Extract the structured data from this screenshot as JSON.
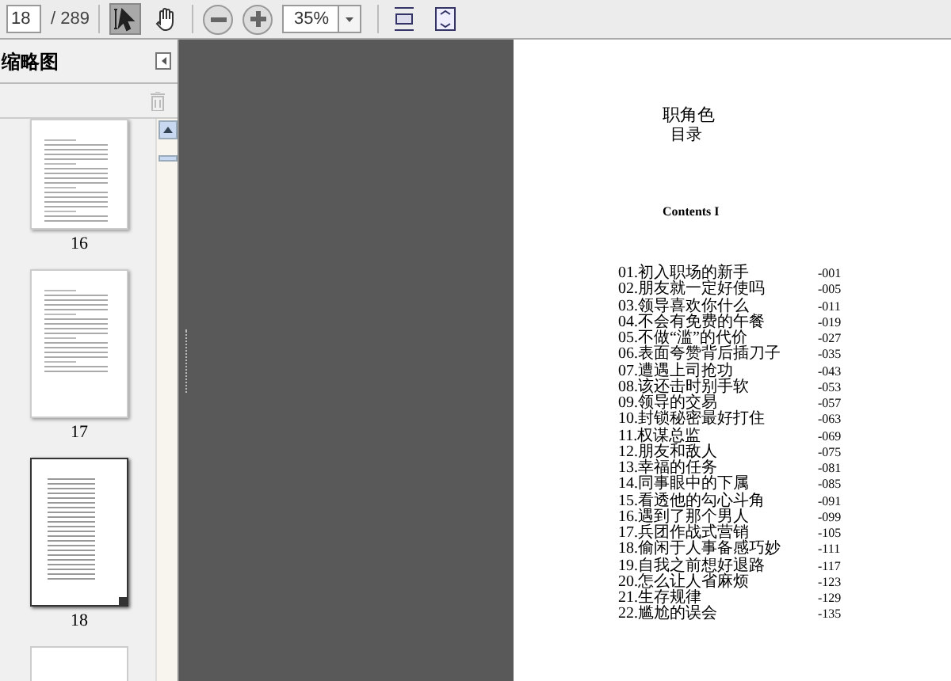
{
  "toolbar": {
    "page_field": "18",
    "page_count": "/ 289",
    "tools": [
      {
        "kind": "select",
        "selected": true
      },
      {
        "kind": "hand",
        "selected": false
      }
    ],
    "zoom": "35%"
  },
  "thumbnails_panel": {
    "title": "缩略图",
    "pages": [
      {
        "label": "16",
        "kind": "text",
        "selected": false
      },
      {
        "label": "17",
        "kind": "text",
        "selected": false
      },
      {
        "label": "18",
        "kind": "contents",
        "selected": true
      }
    ]
  },
  "document": {
    "title": "职角色",
    "subtitle": "目录",
    "heading": "Contents I",
    "entries": [
      {
        "title": "01.初入职场的新手",
        "page": "-001"
      },
      {
        "title": "02.朋友就一定好使吗",
        "page": "-005"
      },
      {
        "title": "03.领导喜欢你什么",
        "page": "-011"
      },
      {
        "title": "04.不会有免费的午餐",
        "page": "-019"
      },
      {
        "title": "05.不做“滥”的代价",
        "page": "-027"
      },
      {
        "title": "06.表面夸赞背后插刀子",
        "page": "-035"
      },
      {
        "title": "07.遭遇上司抢功",
        "page": "-043"
      },
      {
        "title": "08.该还击时别手软",
        "page": "-053"
      },
      {
        "title": "09.领导的交易",
        "page": "-057"
      },
      {
        "title": "10.封锁秘密最好打住",
        "page": "-063"
      },
      {
        "title": "11.权谋总监",
        "page": "-069"
      },
      {
        "title": "12.朋友和敌人",
        "page": "-075"
      },
      {
        "title": "13.幸福的任务",
        "page": "-081"
      },
      {
        "title": "14.同事眼中的下属",
        "page": "-085"
      },
      {
        "title": "15.看透他的勾心斗角",
        "page": "-091"
      },
      {
        "title": "16.遇到了那个男人",
        "page": "-099"
      },
      {
        "title": "17.兵团作战式营销",
        "page": "-105"
      },
      {
        "title": "18.偷闲于人事备感巧妙",
        "page": "-111"
      },
      {
        "title": "19.自我之前想好退路",
        "page": "-117"
      },
      {
        "title": "20.怎么让人省麻烦",
        "page": "-123"
      },
      {
        "title": "21.生存规律",
        "page": "-129"
      },
      {
        "title": "22.尴尬的误会",
        "page": "-135"
      }
    ]
  }
}
